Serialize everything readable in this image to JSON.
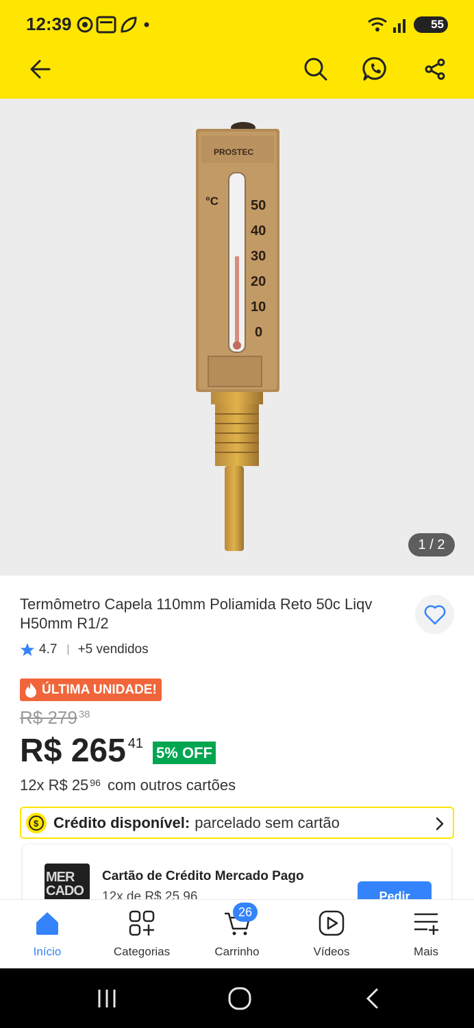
{
  "status": {
    "time": "12:39",
    "battery": "55"
  },
  "gallery": {
    "counter": "1 / 2",
    "thermo_brand": "PROSTEC",
    "thermo_unit": "°C",
    "scale": [
      "50",
      "40",
      "30",
      "20",
      "10",
      "0"
    ]
  },
  "product": {
    "title": "Termômetro Capela 110mm Poliamida Reto 50c Liqv H50mm R1/2",
    "rating": "4.7",
    "sold": "+5 vendidos",
    "badge": "ÚLTIMA UNIDADE!",
    "old_price_main": "R$ 279",
    "old_price_cents": "38",
    "price_main": "R$ 265",
    "price_cents": "41",
    "discount": "5% OFF",
    "installments_prefix": "12x R$ 25",
    "installments_cents": "96",
    "installments_suffix": "com outros cartões"
  },
  "credit": {
    "label_bold": "Crédito disponível:",
    "label_rest": "parcelado sem cartão"
  },
  "card_offer": {
    "title": "Cartão de Crédito Mercado Pago",
    "subtitle": "12x de R$ 25,96",
    "logo_line1": "MER",
    "logo_line2": "CADO",
    "cta": "Pedir"
  },
  "nav": {
    "items": [
      {
        "label": "Início"
      },
      {
        "label": "Categorias"
      },
      {
        "label": "Carrinho"
      },
      {
        "label": "Vídeos"
      },
      {
        "label": "Mais"
      }
    ],
    "cart_count": "26"
  },
  "colors": {
    "brand_yellow": "#ffe600",
    "accent_blue": "#3483fa",
    "discount_green": "#00a650",
    "badge_orange": "#f0663a"
  }
}
